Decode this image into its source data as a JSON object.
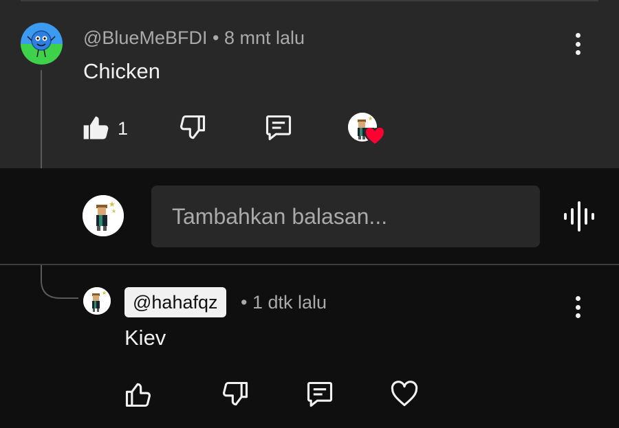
{
  "top_comment": {
    "author": "@BlueMeBFDI",
    "separator": "•",
    "time": "8 mnt lalu",
    "text": "Chicken",
    "like_count": "1"
  },
  "reply_box": {
    "placeholder": "Tambahkan balasan..."
  },
  "reply_comment": {
    "author": "@hahafqz",
    "separator": "•",
    "time": "1 dtk lalu",
    "text": "Kiev"
  },
  "colors": {
    "panel_bg": "#282828",
    "page_bg": "#0f0f0f",
    "text_primary": "#f1f1f1",
    "text_secondary": "#aaaaaa",
    "heart_red": "#ff0033",
    "avatar_blue_top": "#3a9bf0",
    "avatar_green_bottom": "#3ed14a"
  },
  "icons": {
    "like_filled": "thumbs-up-filled-icon",
    "dislike": "thumbs-down-icon",
    "reply": "comment-icon",
    "creator_heart": "heart-icon",
    "more": "more-vert-icon",
    "voice": "voice-search-icon",
    "like_outline": "thumbs-up-icon",
    "heart_outline": "heart-outline-icon"
  }
}
